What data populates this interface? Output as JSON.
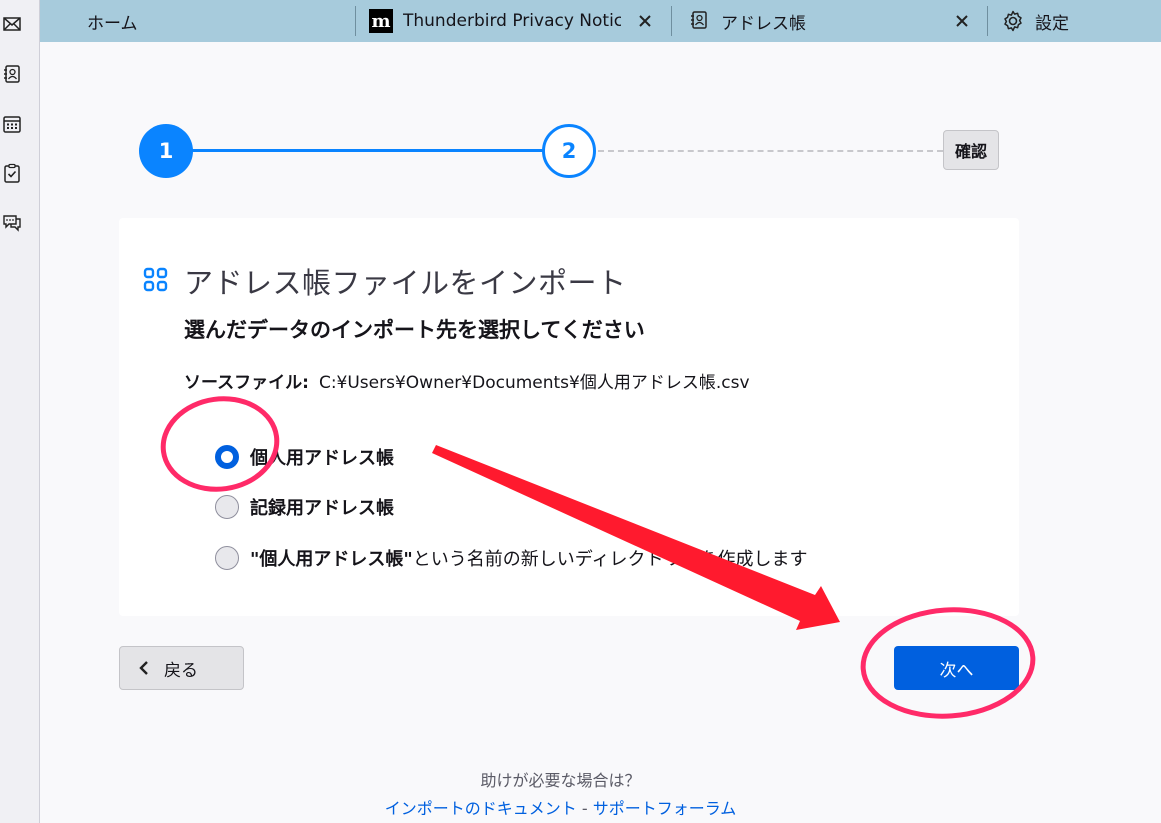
{
  "spaces": {
    "items": [
      {
        "name": "mail"
      },
      {
        "name": "address-book"
      },
      {
        "name": "calendar"
      },
      {
        "name": "tasks"
      },
      {
        "name": "chat"
      }
    ]
  },
  "tabs": [
    {
      "label": "ホーム"
    },
    {
      "label": "Thunderbird Privacy Notice -"
    },
    {
      "label": "アドレス帳"
    },
    {
      "label": "設定"
    }
  ],
  "steps": {
    "step1": "1",
    "step2": "2",
    "confirm": "確認"
  },
  "card": {
    "title": "アドレス帳ファイルをインポート",
    "subtitle": "選んだデータのインポート先を選択してください",
    "source_label": "ソースファイル:",
    "source_path": "C:¥Users¥Owner¥Documents¥個人用アドレス帳.csv",
    "options": [
      {
        "label": "個人用アドレス帳",
        "checked": true
      },
      {
        "label": "記録用アドレス帳",
        "checked": false
      },
      {
        "label": "\"個人用アドレス帳\"",
        "rest": " という名前の新しいディレクトリーを作成します",
        "checked": false
      }
    ]
  },
  "buttons": {
    "back": "戻る",
    "next": "次へ"
  },
  "help": {
    "question": "助けが必要な場合は？",
    "doc_link": "インポートのドキュメント",
    "separator": " - ",
    "forum_link": "サポートフォーラム"
  },
  "colors": {
    "tabbar": "#a7cbdc",
    "accent": "#0a84ff",
    "primary_button": "#0060df",
    "annotation": "#ff2a68"
  }
}
